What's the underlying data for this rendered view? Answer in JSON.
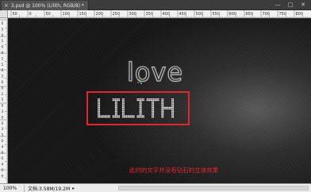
{
  "tab": {
    "title": "3.psd @ 100% (Lilith, RGB/8) *",
    "close_glyph": "×"
  },
  "window_controls": {
    "minimize": "—",
    "maximize": "□",
    "close": "✕"
  },
  "rulers": {
    "horizontal_ticks": [
      "50",
      "0",
      "50",
      "100",
      "150",
      "200",
      "250",
      "300",
      "350",
      "400",
      "450",
      "500",
      "550",
      "600",
      "650",
      "700",
      "750",
      "800"
    ],
    "vertical_ticks": [
      "0",
      "5",
      "0",
      "1",
      "0",
      "0",
      "1",
      "5",
      "0",
      "2",
      "0",
      "0",
      "2",
      "5",
      "0",
      "3",
      "0",
      "0",
      "3",
      "5",
      "0",
      "4",
      "0",
      "0",
      "4",
      "5",
      "0"
    ]
  },
  "canvas": {
    "love_text": "love",
    "lilith_text": "LILITH",
    "caption": "此时的文字并没有钻石的立体效果",
    "accent_color": "#e4252c"
  },
  "status": {
    "zoom": "100%",
    "doc_info": "文档:3.58M/19.2M",
    "arrow": "▸"
  }
}
